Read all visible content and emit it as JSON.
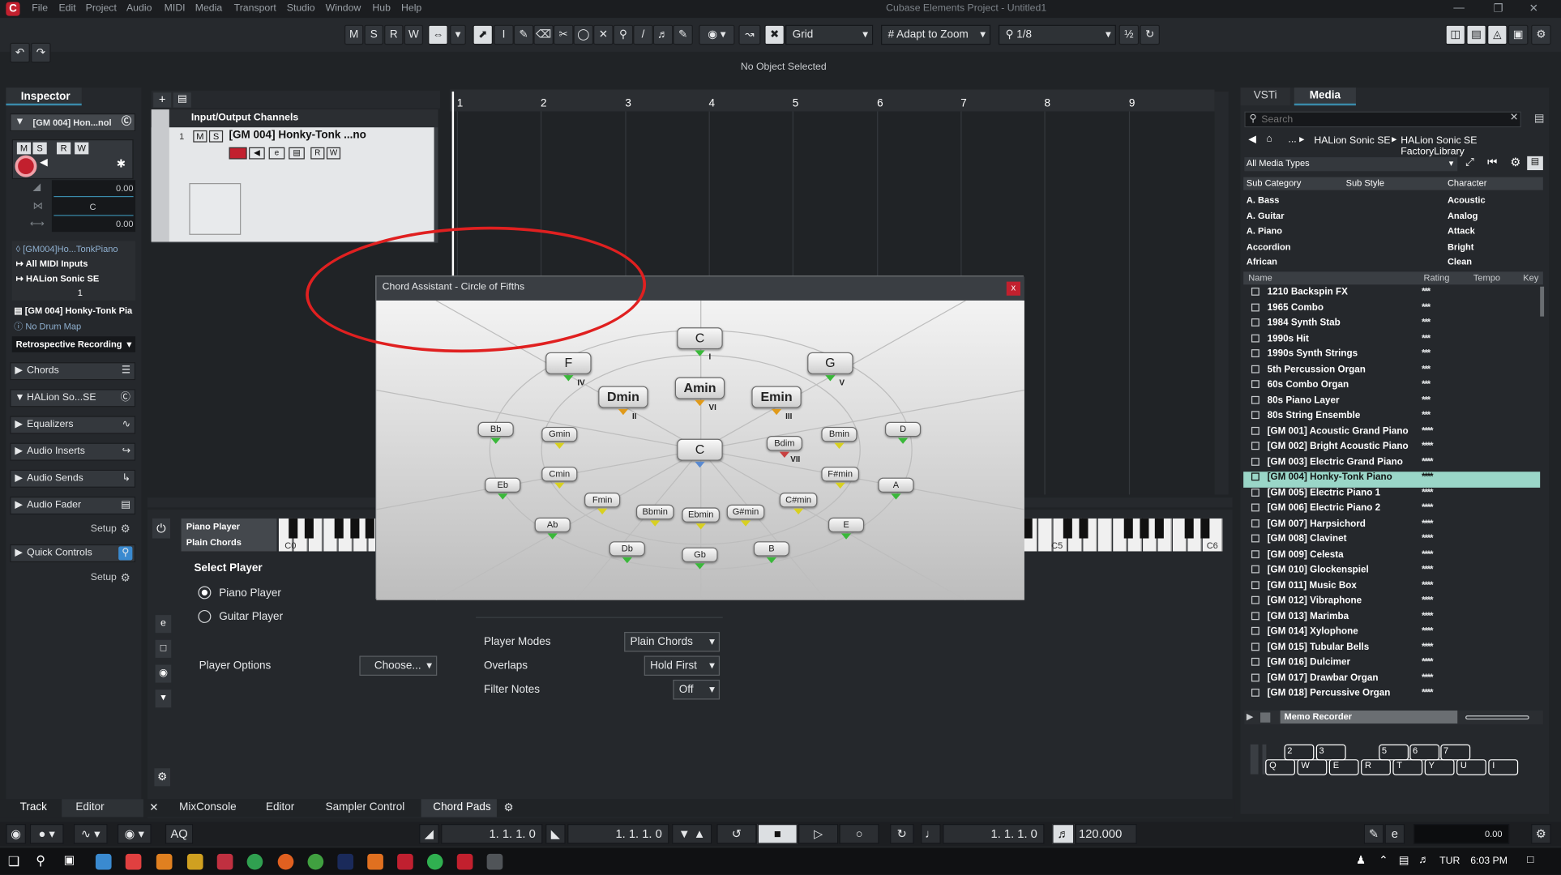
{
  "app": {
    "title": "Cubase Elements Project - Untitled1",
    "status": "No Object Selected"
  },
  "menu": [
    "File",
    "Edit",
    "Project",
    "Audio",
    "MIDI",
    "Media",
    "Transport",
    "Studio",
    "Window",
    "Hub",
    "Help"
  ],
  "toolbar": {
    "m": "M",
    "s": "S",
    "r": "R",
    "w": "W",
    "grid": "Grid",
    "adapt": "Adapt to Zoom",
    "quant": "1/8"
  },
  "inspector": {
    "tab": "Inspector",
    "track_name": "[GM 004] Hon...nol",
    "val1": "0.00",
    "val2": "C",
    "val3": "0.00",
    "instr": "[GM004]Ho...TonkPiano",
    "inputs": "All MIDI Inputs",
    "output": "HALion Sonic SE",
    "chan": "1",
    "program": "[GM 004] Honky-Tonk Pia",
    "drum": "No Drum Map",
    "retro": "Retrospective Recording",
    "sections": [
      "Chords",
      "HALion So...SE",
      "Equalizers",
      "Audio Inserts",
      "Audio Sends",
      "Audio Fader"
    ],
    "setup": "Setup",
    "quick": "Quick Controls"
  },
  "tracks": {
    "header": "Input/Output Channels",
    "row_num": "1",
    "row_name": "[GM 004] Honky-Tonk ...no"
  },
  "ruler": [
    "1",
    "2",
    "3",
    "4",
    "5",
    "6",
    "7",
    "8",
    "9"
  ],
  "chord_assistant": {
    "title": "Chord Assistant - Circle of Fifths",
    "close": "x",
    "main": [
      {
        "label": "C",
        "roman": "I"
      },
      {
        "label": "F",
        "roman": "IV"
      },
      {
        "label": "G",
        "roman": "V"
      },
      {
        "label": "Amin",
        "roman": "VI"
      },
      {
        "label": "Dmin",
        "roman": "II"
      },
      {
        "label": "Emin",
        "roman": "III"
      },
      {
        "label": "C"
      },
      {
        "label": "Bdim",
        "roman": "VII"
      }
    ],
    "small": [
      "Bb",
      "Gmin",
      "Bmin",
      "D",
      "Eb",
      "Cmin",
      "F#min",
      "A",
      "Fmin",
      "Bbmin",
      "Ebmin",
      "G#min",
      "C#min",
      "Ab",
      "E",
      "Db",
      "Gb",
      "B"
    ]
  },
  "lower": {
    "players": [
      "Piano Player",
      "Plain Chords"
    ],
    "select_player": "Select Player",
    "opt1": "Piano Player",
    "opt2": "Guitar Player",
    "player_options": "Player Options",
    "choose": "Choose...",
    "modes_label": "Player Modes",
    "modes_val": "Plain Chords",
    "overlaps_label": "Overlaps",
    "overlaps_val": "Hold First",
    "filter_label": "Filter Notes",
    "filter_val": "Off",
    "c0": "C0",
    "c5": "C5",
    "c6": "C6"
  },
  "media": {
    "tabs": [
      "VSTi",
      "Media"
    ],
    "search_placeholder": "Search",
    "path1": "HALion Sonic SE",
    "path2": "HALion Sonic SE FactoryLibrary",
    "types": "All Media Types",
    "cols": [
      "Sub Category",
      "Sub Style",
      "Character"
    ],
    "cats": [
      "A. Bass",
      "A. Guitar",
      "A. Piano",
      "Accordion",
      "African"
    ],
    "chars": [
      "Acoustic",
      "Analog",
      "Attack",
      "Bright",
      "Clean"
    ],
    "list_cols": [
      "Name",
      "Rating",
      "Tempo",
      "Key"
    ],
    "items": [
      {
        "name": "1210 Backspin FX",
        "rating": "***"
      },
      {
        "name": "1965 Combo",
        "rating": "***"
      },
      {
        "name": "1984 Synth Stab",
        "rating": "***"
      },
      {
        "name": "1990s Hit",
        "rating": "***"
      },
      {
        "name": "1990s Synth Strings",
        "rating": "***"
      },
      {
        "name": "5th Percussion Organ",
        "rating": "***"
      },
      {
        "name": "60s Combo Organ",
        "rating": "***"
      },
      {
        "name": "80s Piano Layer",
        "rating": "***"
      },
      {
        "name": "80s String Ensemble",
        "rating": "***"
      },
      {
        "name": "[GM 001] Acoustic Grand Piano",
        "rating": "****"
      },
      {
        "name": "[GM 002] Bright Acoustic Piano",
        "rating": "****"
      },
      {
        "name": "[GM 003] Electric Grand Piano",
        "rating": "****"
      },
      {
        "name": "[GM 004] Honky-Tonk Piano",
        "rating": "****",
        "selected": true
      },
      {
        "name": "[GM 005] Electric Piano 1",
        "rating": "****"
      },
      {
        "name": "[GM 006] Electric Piano 2",
        "rating": "****"
      },
      {
        "name": "[GM 007] Harpsichord",
        "rating": "****"
      },
      {
        "name": "[GM 008] Clavinet",
        "rating": "****"
      },
      {
        "name": "[GM 009] Celesta",
        "rating": "****"
      },
      {
        "name": "[GM 010] Glockenspiel",
        "rating": "****"
      },
      {
        "name": "[GM 011] Music Box",
        "rating": "****"
      },
      {
        "name": "[GM 012] Vibraphone",
        "rating": "****"
      },
      {
        "name": "[GM 013] Marimba",
        "rating": "****"
      },
      {
        "name": "[GM 014] Xylophone",
        "rating": "****"
      },
      {
        "name": "[GM 015] Tubular Bells",
        "rating": "****"
      },
      {
        "name": "[GM 016] Dulcimer",
        "rating": "****"
      },
      {
        "name": "[GM 017] Drawbar Organ",
        "rating": "****"
      },
      {
        "name": "[GM 018] Percussive Organ",
        "rating": "****"
      }
    ],
    "memo": "Memo Recorder",
    "keys_top": [
      "2",
      "3",
      "5",
      "6",
      "7"
    ],
    "keys": [
      "Q",
      "W",
      "E",
      "R",
      "T",
      "Y",
      "U",
      "I"
    ]
  },
  "bottom_tabs": [
    "Track",
    "Editor",
    "MixConsole",
    "Editor",
    "Sampler Control",
    "Chord Pads"
  ],
  "transport": {
    "aq": "AQ",
    "pos1": "1. 1. 1.  0",
    "pos2": "1. 1. 1.  0",
    "pos3": "1. 1. 1.  0",
    "tempo": "120.000",
    "vol": "0.00"
  },
  "taskbar": {
    "time": "6:03 PM",
    "lang": "TUR"
  }
}
